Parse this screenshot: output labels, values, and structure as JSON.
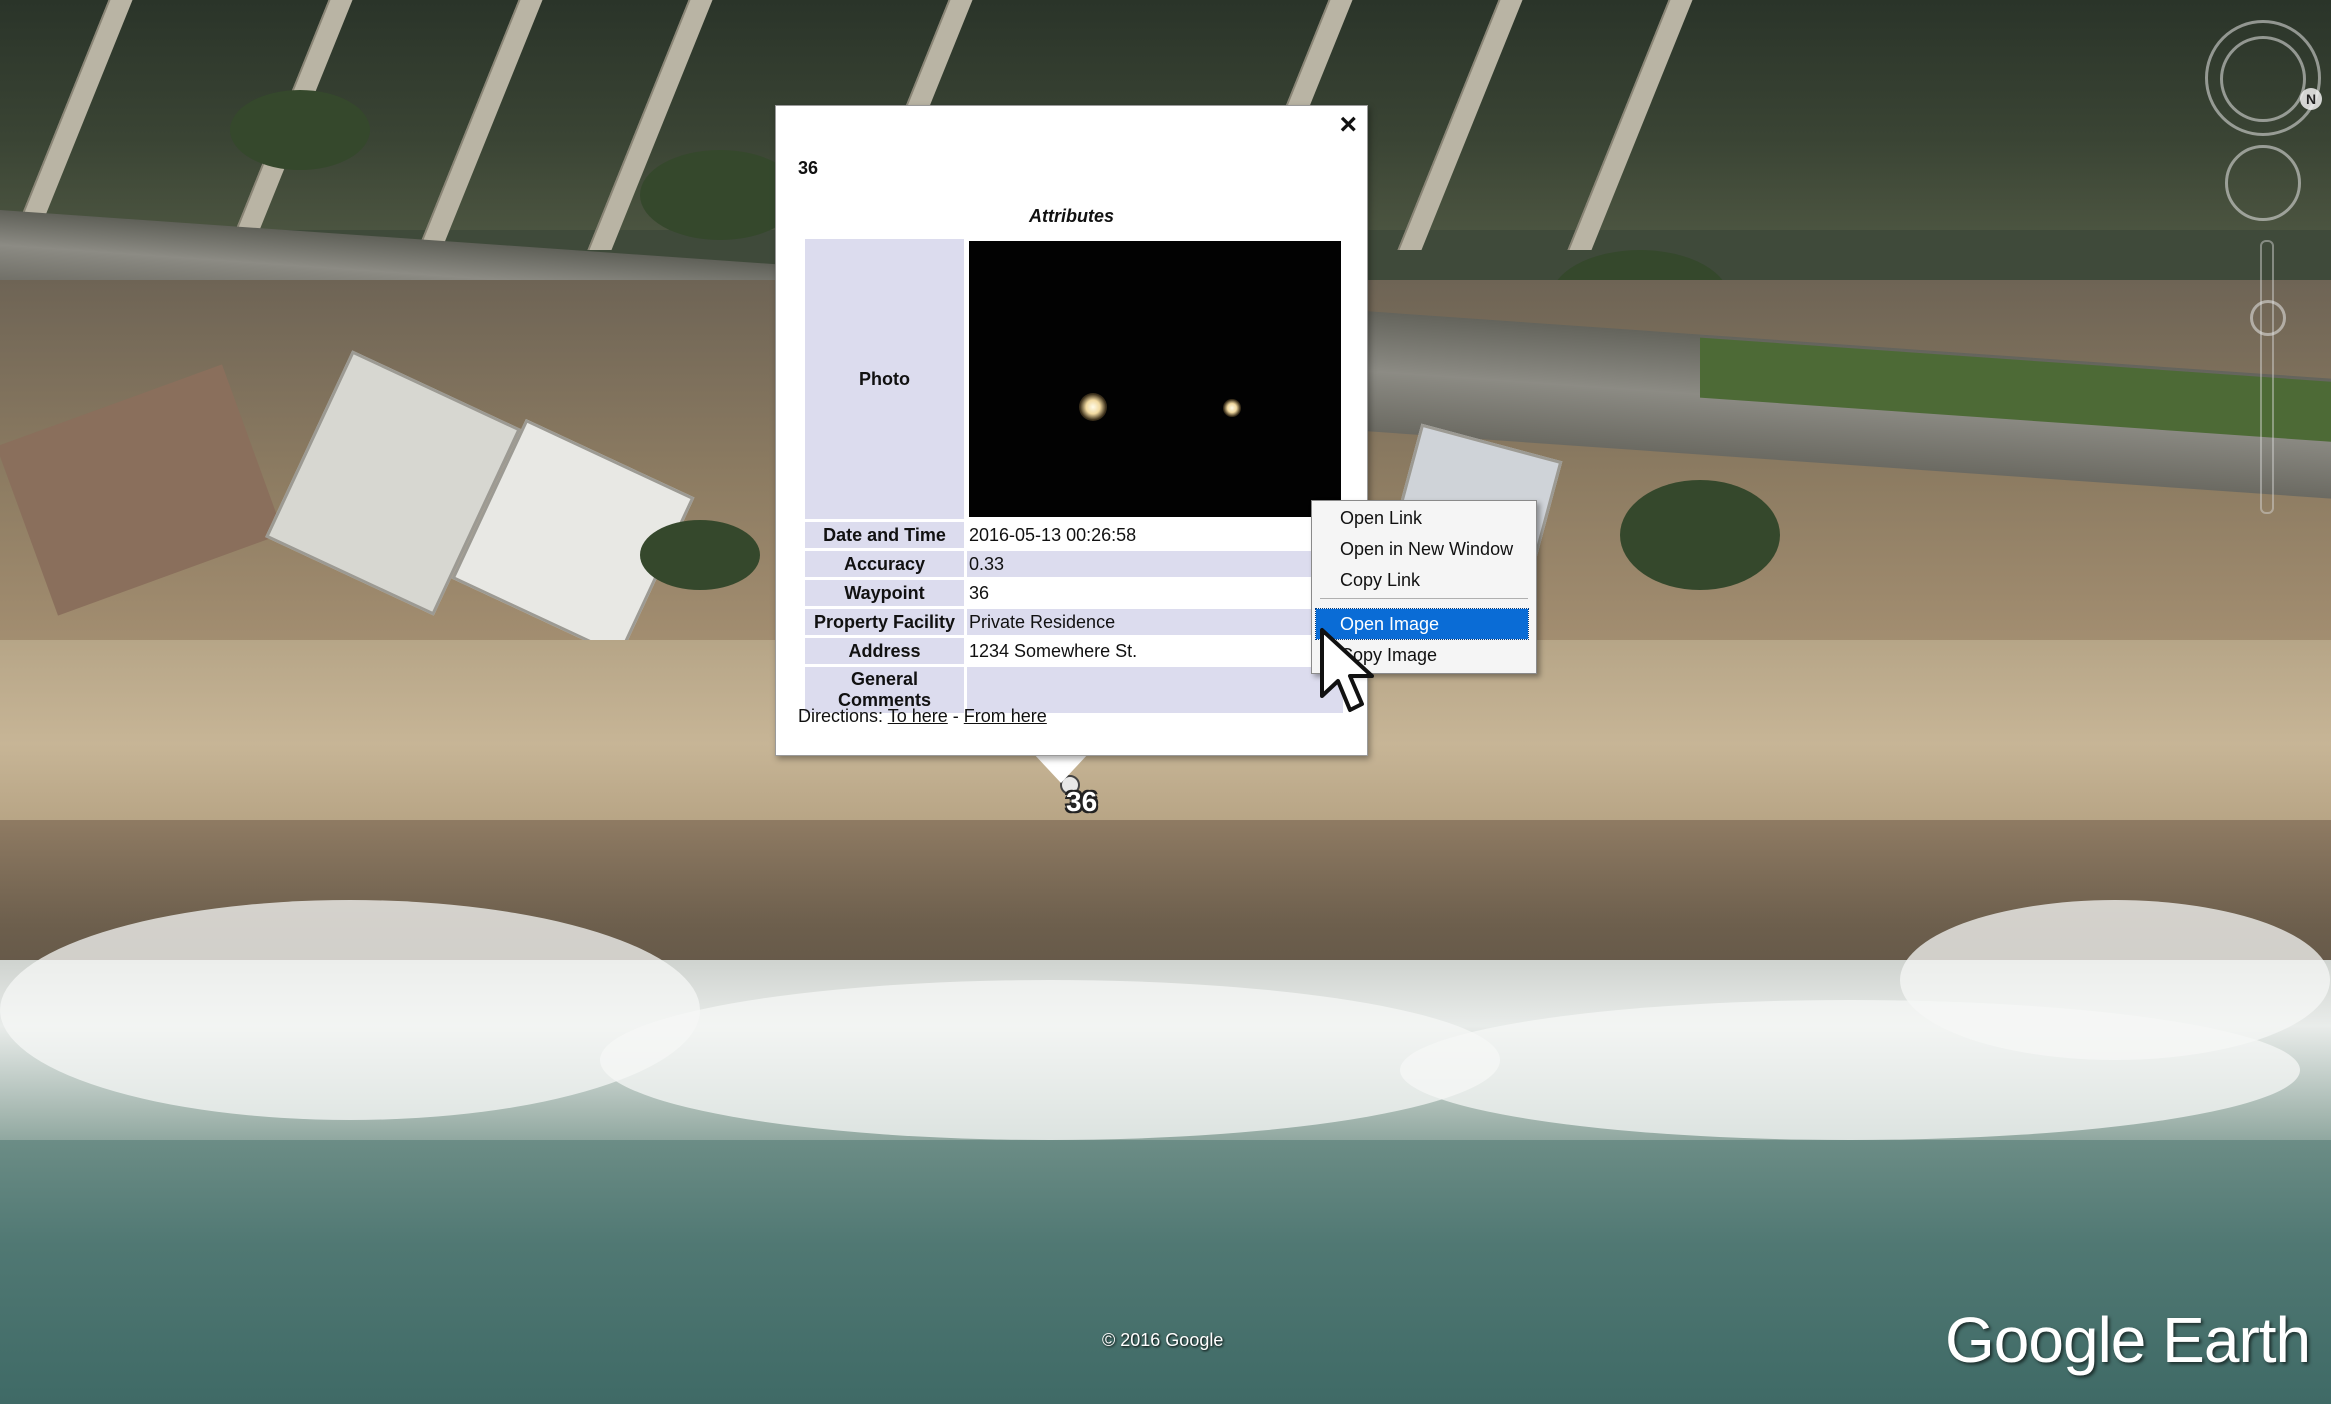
{
  "balloon": {
    "title": "36",
    "attributes_heading": "Attributes",
    "rows": [
      {
        "key": "Photo",
        "value": ""
      },
      {
        "key": "Date and Time",
        "value": "2016-05-13 00:26:58"
      },
      {
        "key": "Accuracy",
        "value": "0.33"
      },
      {
        "key": "Waypoint",
        "value": "36"
      },
      {
        "key": "Property Facility",
        "value": "Private Residence"
      },
      {
        "key": "Address",
        "value": "1234 Somewhere St."
      },
      {
        "key": "General Comments",
        "value": ""
      }
    ],
    "directions_label": "Directions:",
    "to_here": "To here",
    "separator": " - ",
    "from_here": "From here",
    "close_glyph": "×"
  },
  "placemark": {
    "label": "36"
  },
  "context_menu": {
    "items": [
      {
        "label": "Open Link"
      },
      {
        "label": "Open in New Window"
      },
      {
        "label": "Copy Link"
      },
      {
        "label": "Open Image",
        "selected": true
      },
      {
        "label": "Copy Image"
      }
    ]
  },
  "nav": {
    "north": "N"
  },
  "footer": {
    "copyright": "© 2016 Google",
    "logo": "Google Earth"
  },
  "colors": {
    "selection": "#0a6cd6",
    "table_key_bg": "#dcdcee"
  }
}
